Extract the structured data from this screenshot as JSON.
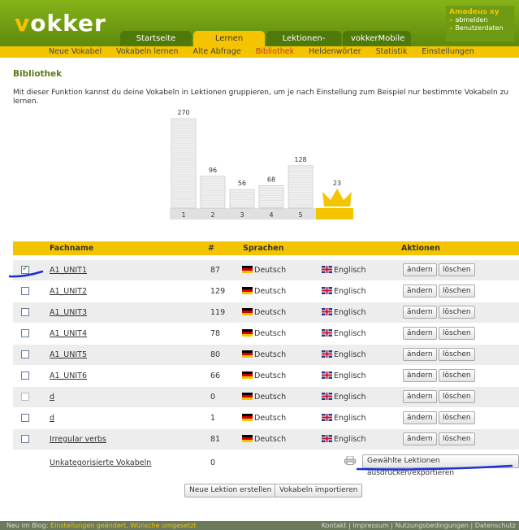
{
  "header": {
    "logo": "vokker",
    "user": {
      "name": "Amadeus xy",
      "logout": "abmelden",
      "account": "Benutzerdaten"
    },
    "tabs": [
      {
        "label": "Startseite",
        "active": false
      },
      {
        "label": "Lernen",
        "active": true
      },
      {
        "label": "Lektionen-Pool",
        "active": false
      },
      {
        "label": "vokkerMobile",
        "active": false
      }
    ]
  },
  "subnav": [
    {
      "label": "Neue Vokabel",
      "active": false
    },
    {
      "label": "Vokabeln lernen",
      "active": false
    },
    {
      "label": "Alte Abfrage",
      "active": false
    },
    {
      "label": "Bibliothek",
      "active": true
    },
    {
      "label": "Heldenwörter",
      "active": false
    },
    {
      "label": "Statistik",
      "active": false
    },
    {
      "label": "Einstellungen",
      "active": false
    }
  ],
  "page": {
    "title": "Bibliothek",
    "intro": "Mit dieser Funktion kannst du deine Vokabeln in Lektionen gruppieren, um je nach Einstellung zum Beispiel nur bestimmte Vokabeln zu lernen."
  },
  "chart_data": {
    "type": "bar",
    "categories": [
      "1",
      "2",
      "3",
      "4",
      "5",
      ""
    ],
    "values": [
      270,
      96,
      56,
      68,
      128,
      23
    ],
    "ylim": [
      0,
      270
    ],
    "colors": {
      "card_stack": "#e6e6e6",
      "crown": "#f5c400",
      "axis_box": "#f5c400"
    }
  },
  "table": {
    "headers": {
      "name": "Fachname",
      "count": "#",
      "languages": "Sprachen",
      "actions": "Aktionen"
    },
    "rows": [
      {
        "name": "A1_UNIT1",
        "count": "87",
        "lang1": "Deutsch",
        "lang2": "Englisch",
        "checked": true,
        "disabled": false
      },
      {
        "name": "A1_UNIT2",
        "count": "129",
        "lang1": "Deutsch",
        "lang2": "Englisch",
        "checked": false,
        "disabled": false
      },
      {
        "name": "A1_UNIT3",
        "count": "119",
        "lang1": "Deutsch",
        "lang2": "Englisch",
        "checked": false,
        "disabled": false
      },
      {
        "name": "A1_UNIT4",
        "count": "78",
        "lang1": "Deutsch",
        "lang2": "Englisch",
        "checked": false,
        "disabled": false
      },
      {
        "name": "A1_UNIT5",
        "count": "80",
        "lang1": "Deutsch",
        "lang2": "Englisch",
        "checked": false,
        "disabled": false
      },
      {
        "name": "A1_UNIT6",
        "count": "66",
        "lang1": "Deutsch",
        "lang2": "Englisch",
        "checked": false,
        "disabled": false
      },
      {
        "name": "d",
        "count": "0",
        "lang1": "Deutsch",
        "lang2": "Englisch",
        "checked": false,
        "disabled": true
      },
      {
        "name": "d",
        "count": "1",
        "lang1": "Deutsch",
        "lang2": "Englisch",
        "checked": false,
        "disabled": false
      },
      {
        "name": "Irregular verbs",
        "count": "81",
        "lang1": "Deutsch",
        "lang2": "Englisch",
        "checked": false,
        "disabled": false
      }
    ],
    "edit_label": "ändern",
    "delete_label": "löschen",
    "uncategorized": {
      "name": "Unkategorisierte Vokabeln",
      "count": "0"
    },
    "export_label": "Gewählte Lektionen ausdrucken/exportieren"
  },
  "buttons": {
    "new_lesson": "Neue Lektion erstellen",
    "import": "Vokabeln importieren"
  },
  "footer": {
    "blog_prefix": "Neu im Blog:",
    "blog_link": "Einstellungen geändert, Wünsche umgesetzt",
    "links": "Kontakt | Impressum | Nutzungsbedingungen | Datenschutz"
  },
  "colors": {
    "brand_green": "#6f9a14",
    "accent_yellow": "#f5c400",
    "annotation_blue": "#1a2fd6"
  }
}
